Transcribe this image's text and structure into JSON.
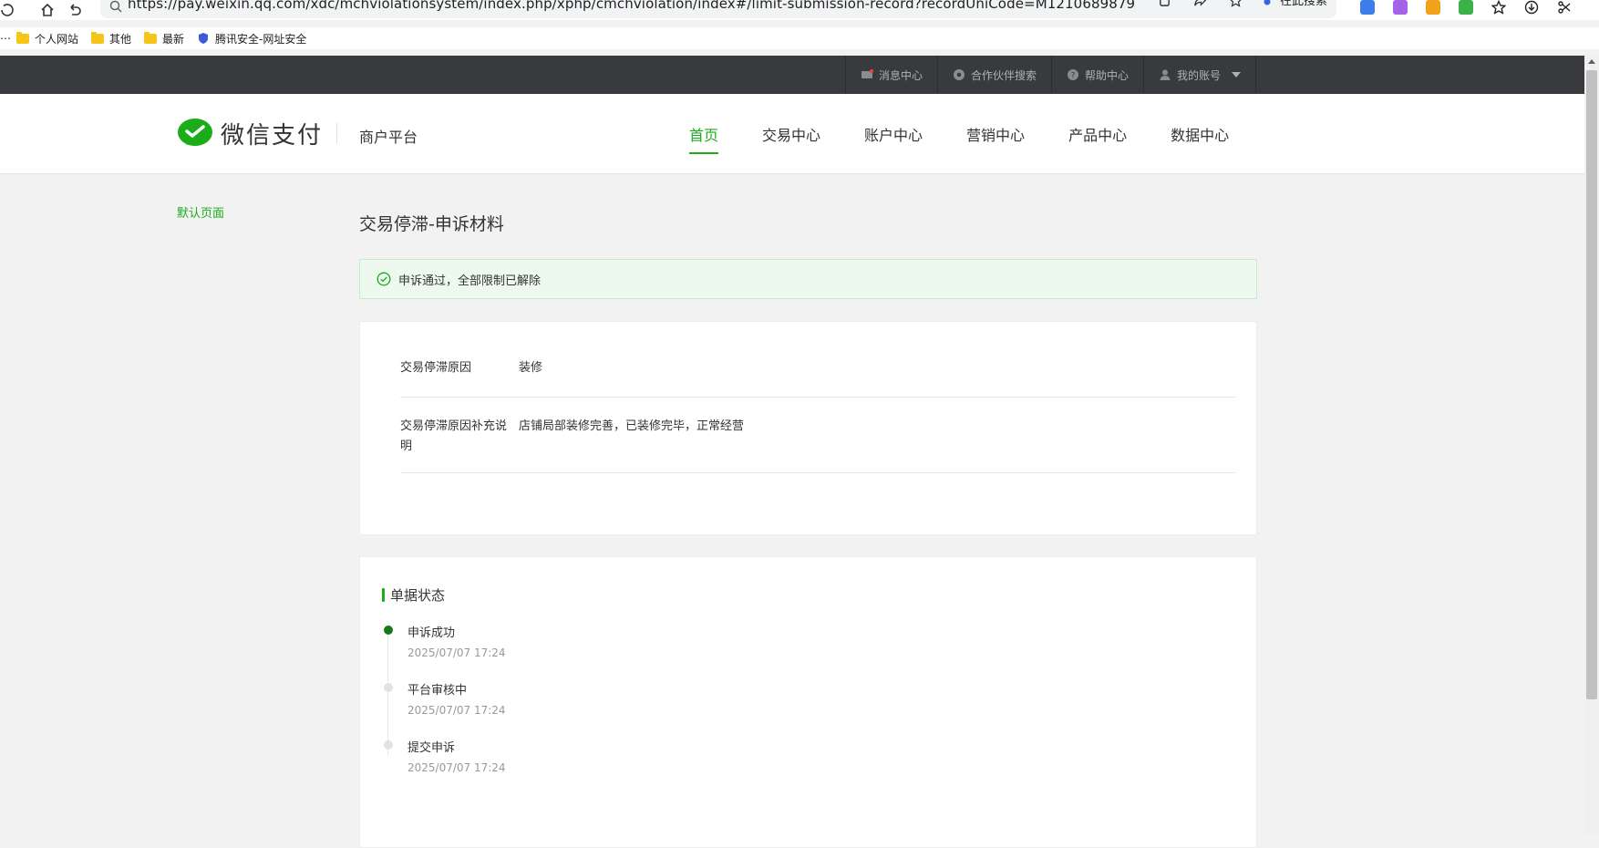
{
  "browser": {
    "url": "https://pay.weixin.qq.com/xdc/mchviolationsystem/index.php/xphp/cmchviolation/index#/limit-submission-record?recordUniCode=M1210689879",
    "search_engine_label": "在此搜索",
    "bookmarks": [
      {
        "label": "个人网站",
        "icon": "folder-icon"
      },
      {
        "label": "其他",
        "icon": "folder-icon"
      },
      {
        "label": "最新",
        "icon": "folder-icon"
      },
      {
        "label": "腾讯安全-网址安全",
        "icon": "shield-icon"
      }
    ]
  },
  "topbar": {
    "links": [
      {
        "label": "消息中心",
        "icon": "mail-icon"
      },
      {
        "label": "合作伙伴搜索",
        "icon": "partner-icon"
      },
      {
        "label": "帮助中心",
        "icon": "help-icon"
      },
      {
        "label": "我的账号",
        "icon": "user-icon"
      }
    ],
    "notification_color": "#e64340"
  },
  "header": {
    "logo_text": "微信支付",
    "platform_name": "商户平台",
    "nav": [
      {
        "label": "首页",
        "active": true
      },
      {
        "label": "交易中心",
        "active": false
      },
      {
        "label": "账户中心",
        "active": false
      },
      {
        "label": "营销中心",
        "active": false
      },
      {
        "label": "产品中心",
        "active": false
      },
      {
        "label": "数据中心",
        "active": false
      }
    ],
    "accent_color": "#1aad19"
  },
  "sidebar": {
    "link": "默认页面"
  },
  "main": {
    "title": "交易停滞-申诉材料",
    "alert_text": "申诉通过，全部限制已解除",
    "info": [
      {
        "label": "交易停滞原因",
        "value": "装修"
      },
      {
        "label": "交易停滞原因补充说明",
        "value": "店铺局部装修完善，已装修完毕，正常经营"
      }
    ],
    "status": {
      "title": "单据状态",
      "steps": [
        {
          "title": "申诉成功",
          "time": "2025/07/07 17:24",
          "done": true
        },
        {
          "title": "平台审核中",
          "time": "2025/07/07 17:24",
          "done": false
        },
        {
          "title": "提交申诉",
          "time": "2025/07/07 17:24",
          "done": false
        }
      ]
    }
  }
}
